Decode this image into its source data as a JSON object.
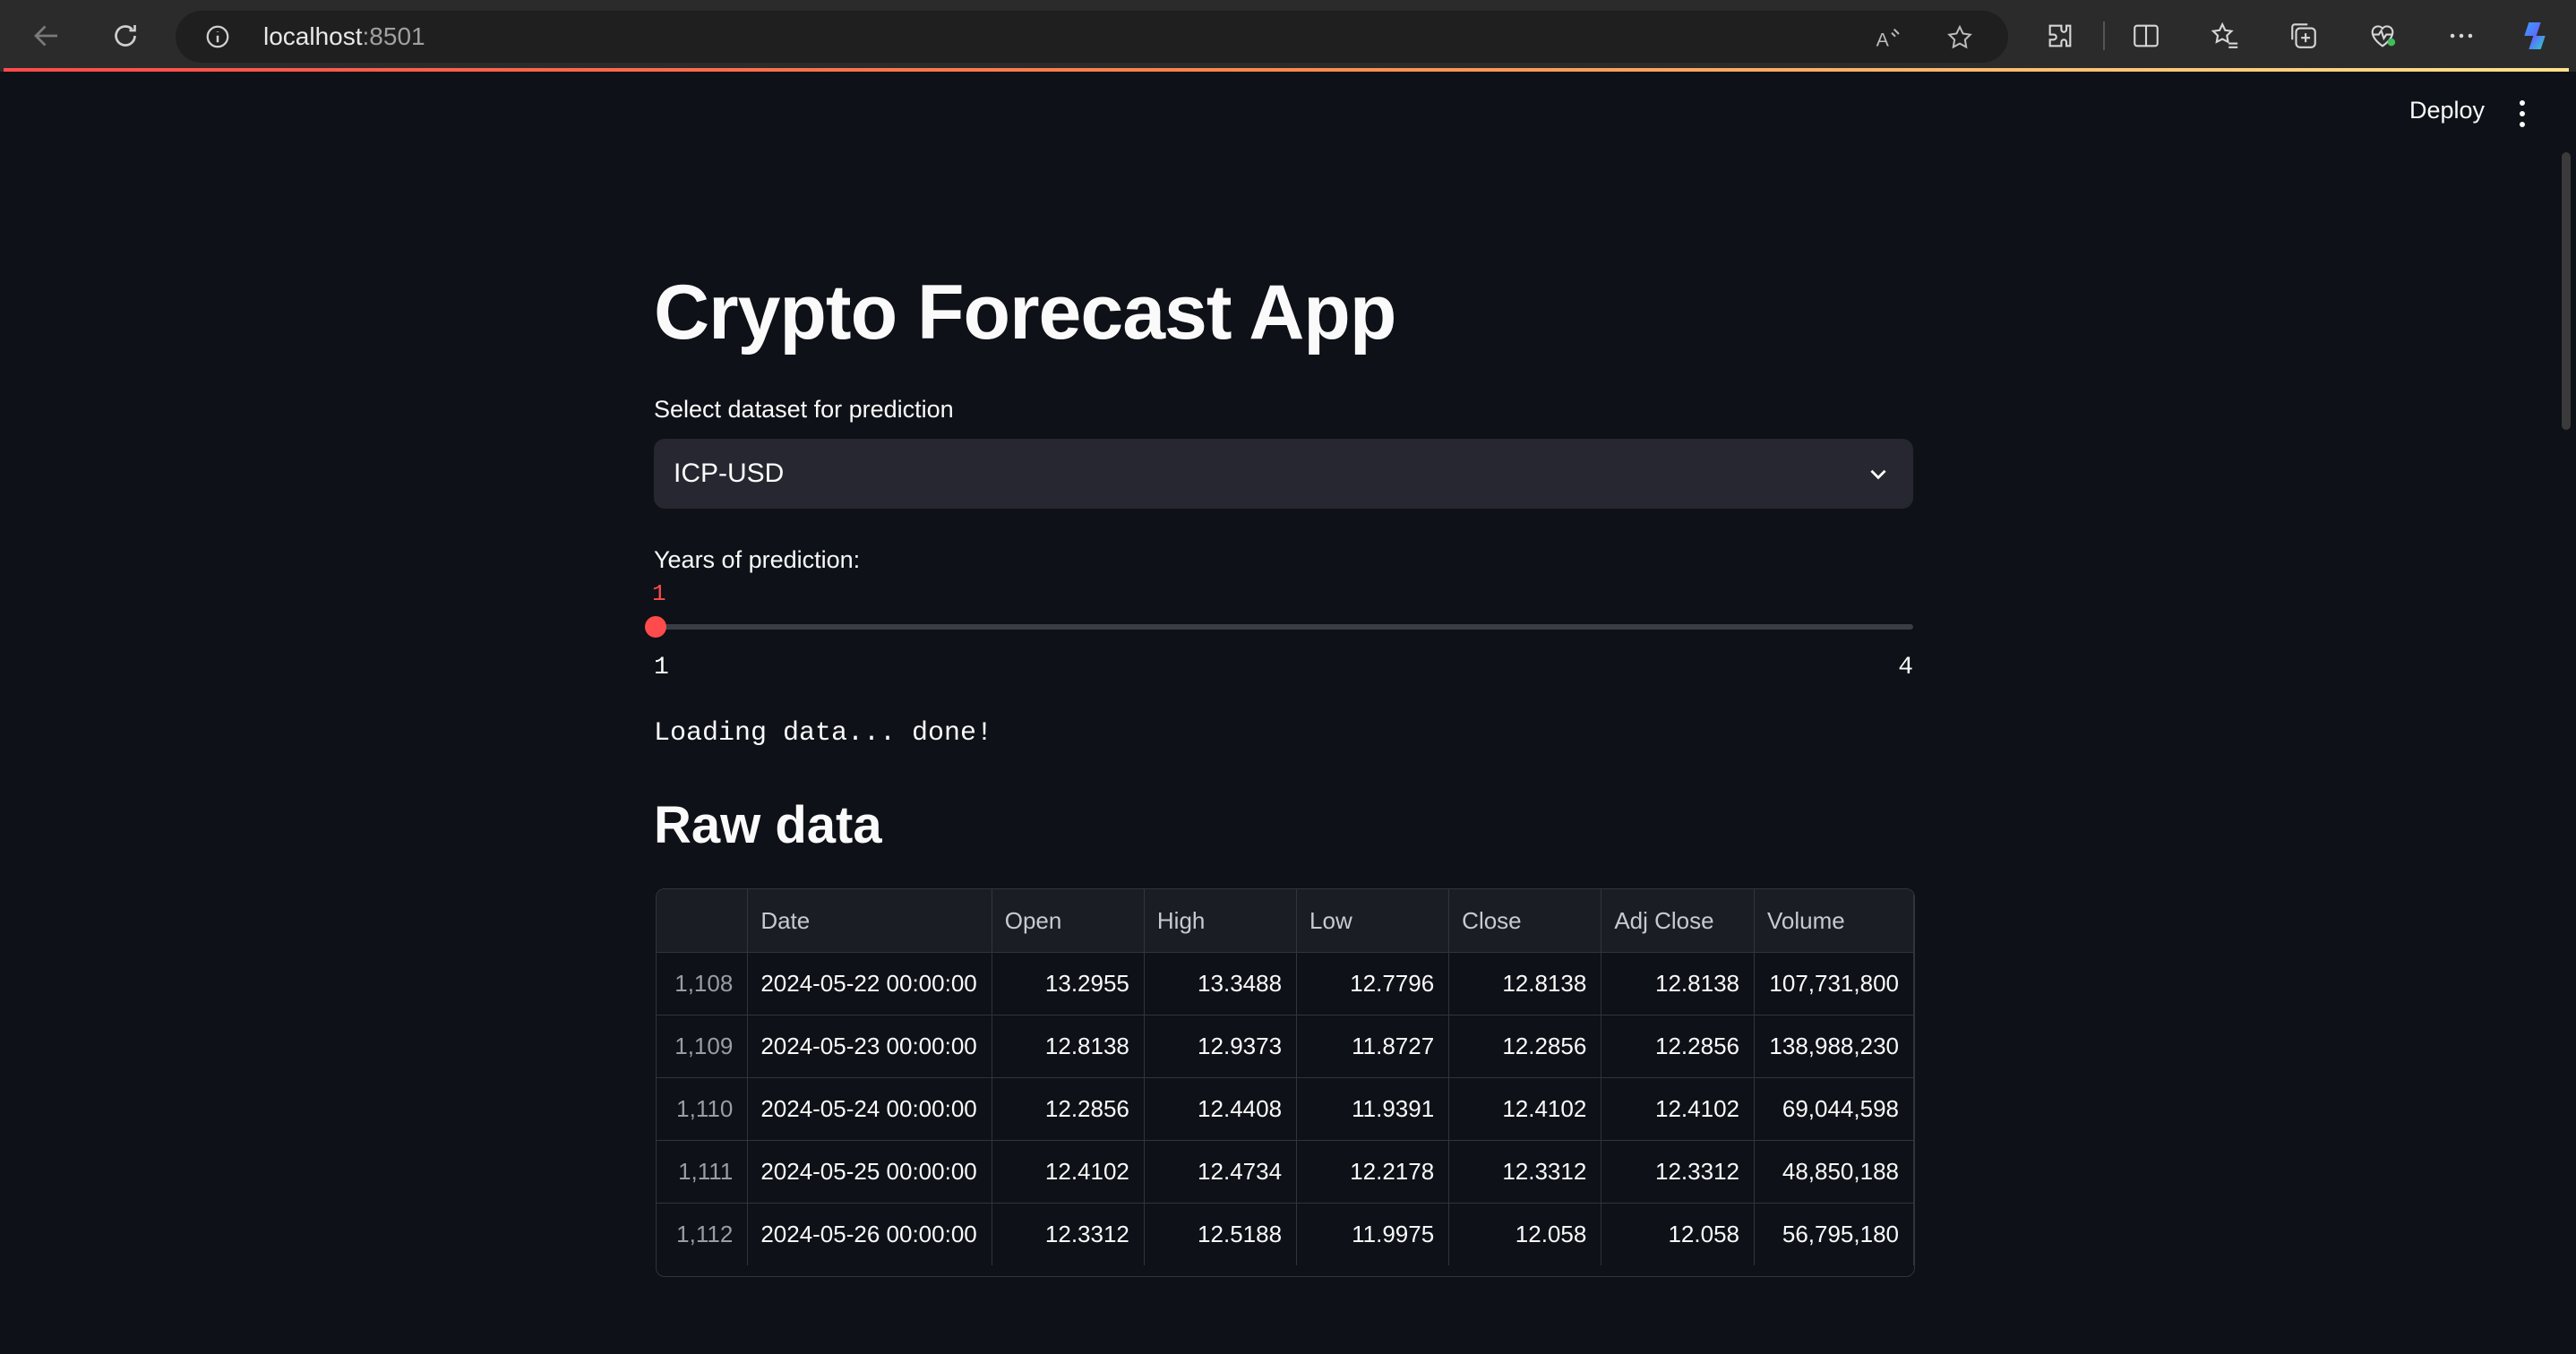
{
  "browser": {
    "url_host": "localhost",
    "url_port": ":8501",
    "icons": [
      "back-arrow-icon",
      "refresh-icon",
      "info-icon",
      "read-aloud-icon",
      "favorite-star-icon",
      "extensions-icon",
      "split-screen-icon",
      "favorites-icon",
      "collections-icon",
      "browser-essentials-icon",
      "more-icon",
      "copilot-icon"
    ]
  },
  "header": {
    "deploy_label": "Deploy"
  },
  "app": {
    "title": "Crypto Forecast App",
    "dataset": {
      "label": "Select dataset for prediction",
      "value": "ICP-USD"
    },
    "years": {
      "label": "Years of prediction:",
      "value": "1",
      "min": "1",
      "max": "4",
      "fraction": 0
    },
    "loading_text": "Loading data... done!",
    "raw_data": {
      "heading": "Raw data",
      "columns": [
        "",
        "Date",
        "Open",
        "High",
        "Low",
        "Close",
        "Adj Close",
        "Volume"
      ],
      "rows": [
        [
          "1,108",
          "2024-05-22 00:00:00",
          "13.2955",
          "13.3488",
          "12.7796",
          "12.8138",
          "12.8138",
          "107,731,800"
        ],
        [
          "1,109",
          "2024-05-23 00:00:00",
          "12.8138",
          "12.9373",
          "11.8727",
          "12.2856",
          "12.2856",
          "138,988,230"
        ],
        [
          "1,110",
          "2024-05-24 00:00:00",
          "12.2856",
          "12.4408",
          "11.9391",
          "12.4102",
          "12.4102",
          "69,044,598"
        ],
        [
          "1,111",
          "2024-05-25 00:00:00",
          "12.4102",
          "12.4734",
          "12.2178",
          "12.3312",
          "12.3312",
          "48,850,188"
        ],
        [
          "1,112",
          "2024-05-26 00:00:00",
          "12.3312",
          "12.5188",
          "11.9975",
          "12.058",
          "12.058",
          "56,795,180"
        ]
      ]
    }
  },
  "colors": {
    "background": "#0e1117",
    "accent": "#ff4b4b",
    "select_bg": "#262730"
  }
}
